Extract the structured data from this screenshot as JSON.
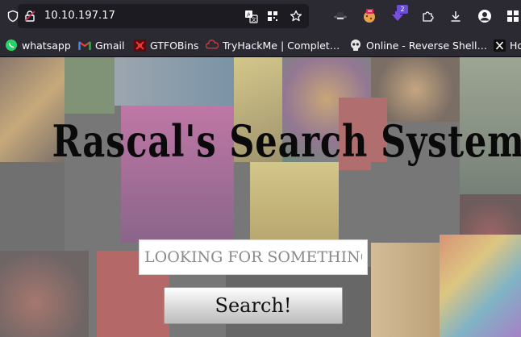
{
  "browser": {
    "url": "10.10.197.17",
    "extension_badge": "2"
  },
  "bookmarks": [
    {
      "label": "whatsapp",
      "icon": "whatsapp-icon"
    },
    {
      "label": "Gmail",
      "icon": "gmail-icon"
    },
    {
      "label": "GTFOBins",
      "icon": "gtfobins-icon"
    },
    {
      "label": "TryHackMe | Complet…",
      "icon": "tryhackme-icon"
    },
    {
      "label": "Online - Reverse Shell…",
      "icon": "skull-icon"
    },
    {
      "label": "Ho",
      "icon": "x-icon"
    }
  ],
  "page": {
    "title": "Rascal's Search System",
    "search_placeholder": "Looking for something?",
    "search_button": "Search!"
  },
  "colors": {
    "toolbar_bg": "#2b2a33",
    "urlbar_bg": "#1c1b22",
    "text": "#fbfbfe",
    "title": "#0a0a0a"
  }
}
